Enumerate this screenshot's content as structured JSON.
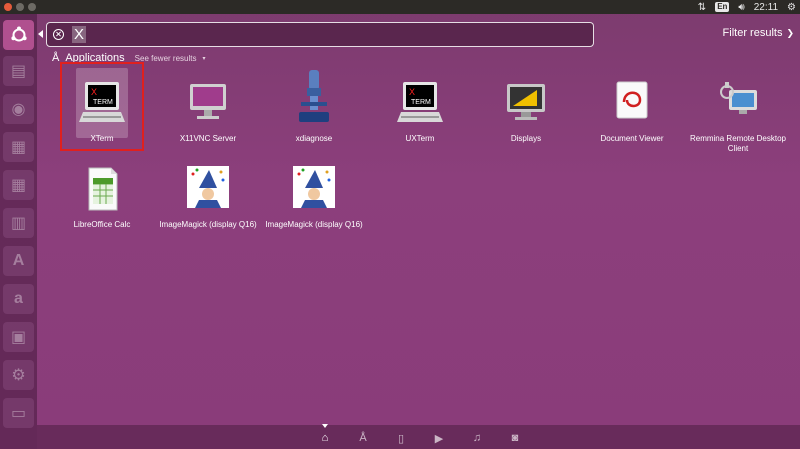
{
  "panel": {
    "time": "22:11",
    "keyboard_layout": "En"
  },
  "search": {
    "query": "X"
  },
  "filter": {
    "label": "Filter results"
  },
  "category": {
    "title": "Applications",
    "see_fewer": "See fewer results"
  },
  "apps": [
    {
      "label": "XTerm",
      "icon": "xterm-icon"
    },
    {
      "label": "X11VNC Server",
      "icon": "monitor-icon"
    },
    {
      "label": "xdiagnose",
      "icon": "microscope-icon"
    },
    {
      "label": "UXTerm",
      "icon": "xterm-icon"
    },
    {
      "label": "Displays",
      "icon": "displays-icon"
    },
    {
      "label": "Document Viewer",
      "icon": "document-viewer-icon"
    },
    {
      "label": "Remmina Remote Desktop Client",
      "icon": "remmina-icon"
    },
    {
      "label": "LibreOffice Calc",
      "icon": "spreadsheet-icon"
    },
    {
      "label": "ImageMagick (display Q16)",
      "icon": "wizard-icon"
    },
    {
      "label": "ImageMagick (display Q16)",
      "icon": "wizard-icon"
    }
  ],
  "lenses": [
    "home",
    "applications",
    "files",
    "video",
    "music",
    "photos"
  ],
  "accent_colors": {
    "selection": "#e0201e",
    "launcher_active": "#b0508f"
  }
}
